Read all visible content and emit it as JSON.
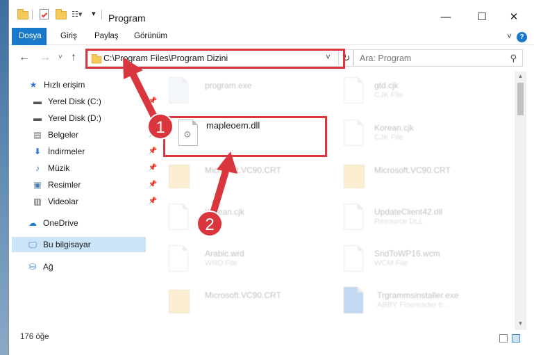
{
  "window": {
    "title": "Program"
  },
  "tabs": [
    {
      "label": "Dosya"
    },
    {
      "label": "Giriş"
    },
    {
      "label": "Paylaş"
    },
    {
      "label": "Görünüm"
    }
  ],
  "address": {
    "path": "C:\\Program Files\\Program Dizini"
  },
  "search": {
    "placeholder": "Ara: Program"
  },
  "sidebar": {
    "items": [
      {
        "label": "Hızlı erişim",
        "icon": "star-icon"
      },
      {
        "label": "Yerel Disk (C:)",
        "icon": "drive-icon"
      },
      {
        "label": "Yerel Disk (D:)",
        "icon": "drive-icon"
      },
      {
        "label": "Belgeler",
        "icon": "document-icon"
      },
      {
        "label": "İndirmeler",
        "icon": "download-icon"
      },
      {
        "label": "Müzik",
        "icon": "music-icon"
      },
      {
        "label": "Resimler",
        "icon": "picture-icon"
      },
      {
        "label": "Videolar",
        "icon": "video-icon"
      },
      {
        "label": "OneDrive",
        "icon": "cloud-icon"
      },
      {
        "label": "Bu bilgisayar",
        "icon": "computer-icon"
      },
      {
        "label": "Ağ",
        "icon": "network-icon"
      }
    ]
  },
  "files": [
    {
      "name": "program.exe",
      "sub": ""
    },
    {
      "name": "gtd.cjk",
      "sub": "CJK File"
    },
    {
      "name": "mapleoem.dll",
      "sub": ""
    },
    {
      "name": "Korean.cjk",
      "sub": "CJK File"
    },
    {
      "name": "Microsoft.VC90.CRT",
      "sub": ""
    },
    {
      "name": "Microsoft.VC90.CRT",
      "sub": ""
    },
    {
      "name": "Korean.cjk",
      "sub": ""
    },
    {
      "name": "UpdateClient42.dll",
      "sub": "Resource DLL"
    },
    {
      "name": "Arabic.wrd",
      "sub": "WRD File"
    },
    {
      "name": "SndToWP16.wcm",
      "sub": "WCM File"
    },
    {
      "name": "Microsoft.VC90.CRT",
      "sub": ""
    },
    {
      "name": "Trgrammsinstaller.exe",
      "sub": "ABBY Finereader tr..."
    }
  ],
  "status": {
    "count": "176 öğe"
  },
  "annotations": {
    "step1": "1",
    "step2": "2",
    "color": "#d9363e"
  },
  "colors": {
    "accent": "#1979ca",
    "selection": "#cce4f7",
    "highlight": "#d9363e"
  }
}
